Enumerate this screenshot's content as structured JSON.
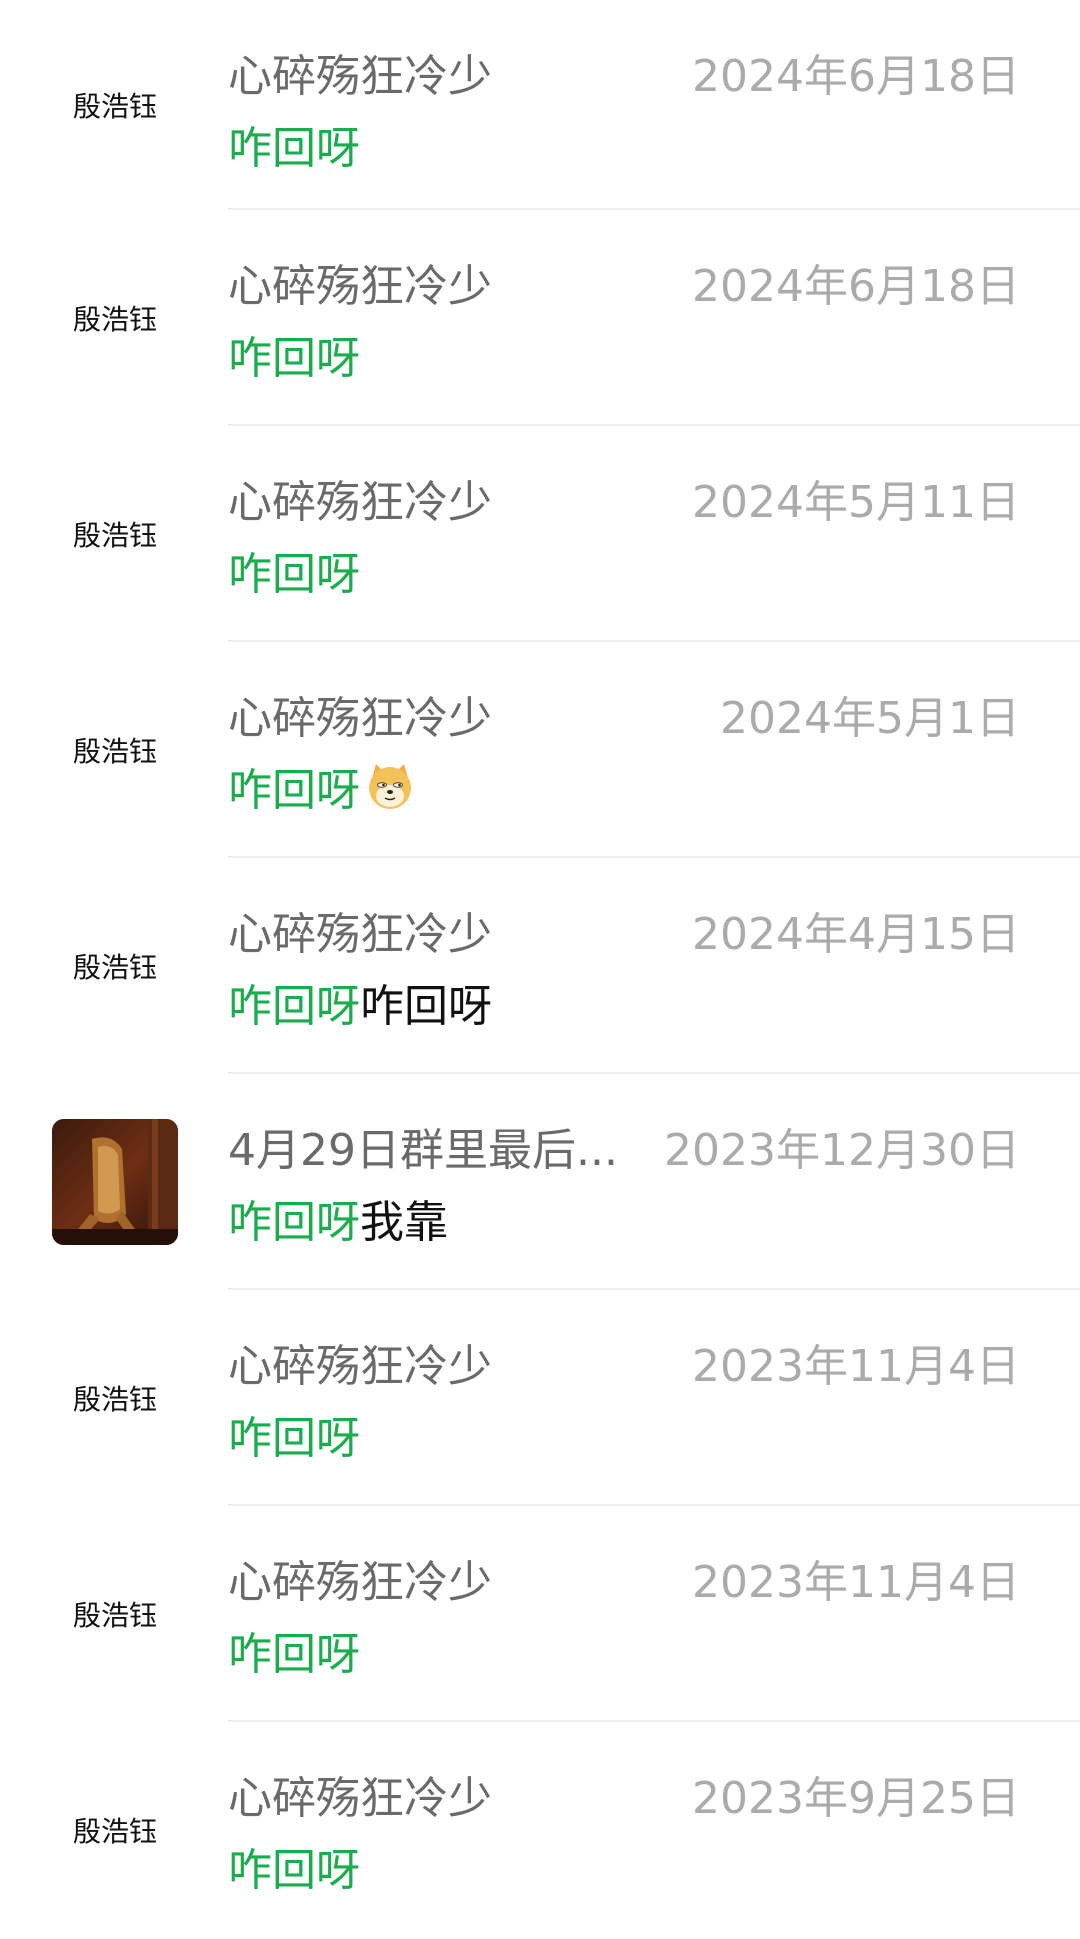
{
  "items": [
    {
      "avatar_label": "殷浩钰",
      "name": "心碎殇狂冷少",
      "date": "2024年6月18日",
      "msg_hl": "咋回呀",
      "msg_rest": ""
    },
    {
      "avatar_label": "殷浩钰",
      "name": "心碎殇狂冷少",
      "date": "2024年6月18日",
      "msg_hl": "咋回呀",
      "msg_rest": ""
    },
    {
      "avatar_label": "殷浩钰",
      "name": "心碎殇狂冷少",
      "date": "2024年5月11日",
      "msg_hl": "咋回呀",
      "msg_rest": ""
    },
    {
      "avatar_label": "殷浩钰",
      "name": "心碎殇狂冷少",
      "date": "2024年5月1日",
      "msg_hl": "咋回呀",
      "msg_rest": "",
      "emoji": "doge-emoji"
    },
    {
      "avatar_label": "殷浩钰",
      "name": "心碎殇狂冷少",
      "date": "2024年4月15日",
      "msg_hl": "咋回呀",
      "msg_rest": "咋回呀"
    },
    {
      "avatar_label": "",
      "avatar_image": "painting-chair-image",
      "name": "4月29日群里最后...",
      "date": "2023年12月30日",
      "msg_hl": "咋回呀",
      "msg_rest": "我靠"
    },
    {
      "avatar_label": "殷浩钰",
      "name": "心碎殇狂冷少",
      "date": "2023年11月4日",
      "msg_hl": "咋回呀",
      "msg_rest": ""
    },
    {
      "avatar_label": "殷浩钰",
      "name": "心碎殇狂冷少",
      "date": "2023年11月4日",
      "msg_hl": "咋回呀",
      "msg_rest": ""
    },
    {
      "avatar_label": "殷浩钰",
      "name": "心碎殇狂冷少",
      "date": "2023年9月25日",
      "msg_hl": "咋回呀",
      "msg_rest": ""
    }
  ],
  "colors": {
    "highlight": "#1aad4e",
    "name": "#6a6a6a",
    "date": "#ababab",
    "text": "#111111",
    "divider": "#ededed"
  }
}
